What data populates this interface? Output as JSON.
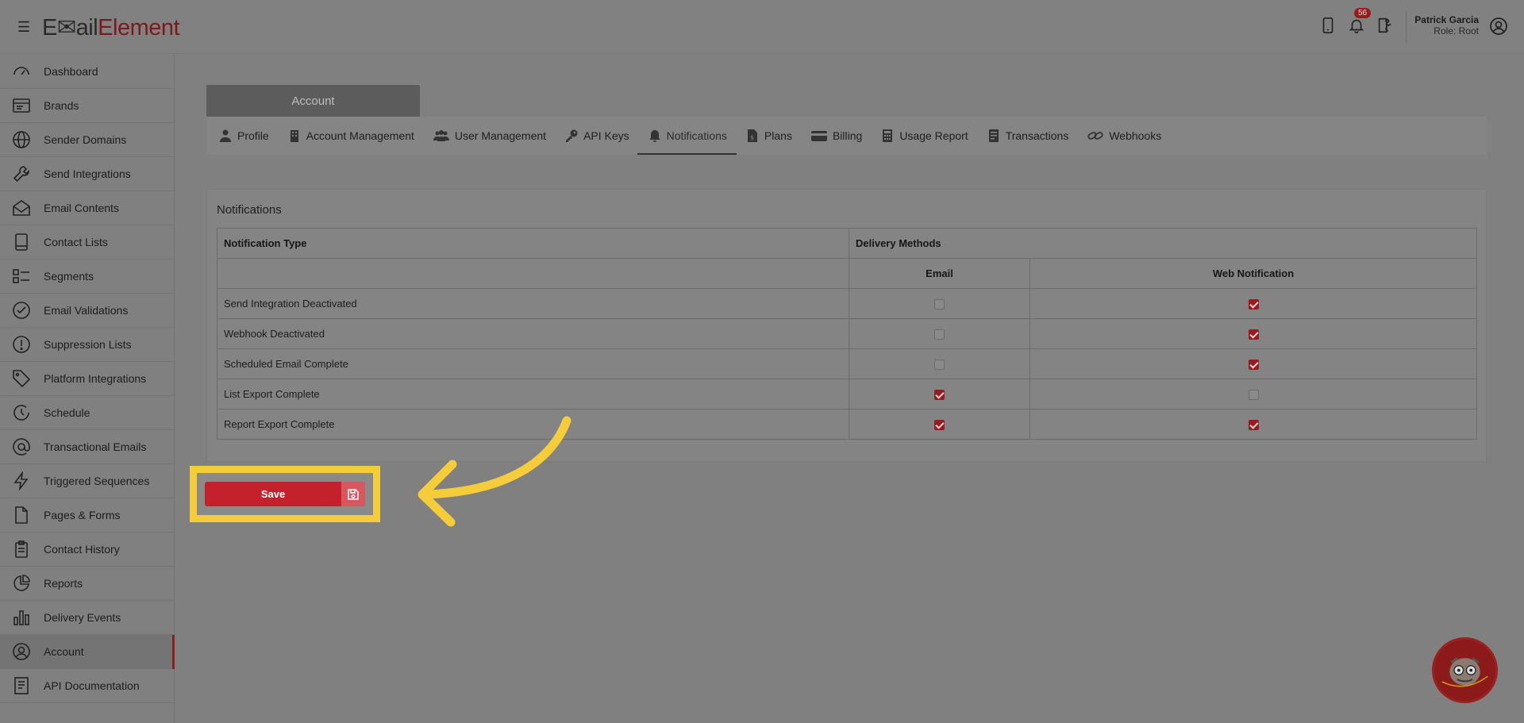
{
  "header": {
    "logo_part1": "E",
    "logo_part2": "ail",
    "logo_part3": "Element",
    "notification_count": "56",
    "user_name": "Patrick Garcia",
    "user_role": "Role: Root"
  },
  "sidebar": {
    "items": [
      {
        "label": "Dashboard",
        "icon": "gauge-icon"
      },
      {
        "label": "Brands",
        "icon": "brands-icon"
      },
      {
        "label": "Sender Domains",
        "icon": "globe-icon"
      },
      {
        "label": "Send Integrations",
        "icon": "wrench-icon"
      },
      {
        "label": "Email Contents",
        "icon": "envelope-open-icon"
      },
      {
        "label": "Contact Lists",
        "icon": "book-icon"
      },
      {
        "label": "Segments",
        "icon": "segments-icon"
      },
      {
        "label": "Email Validations",
        "icon": "check-circle-icon"
      },
      {
        "label": "Suppression Lists",
        "icon": "exclamation-circle-icon"
      },
      {
        "label": "Platform Integrations",
        "icon": "tag-icon"
      },
      {
        "label": "Schedule",
        "icon": "clock-icon"
      },
      {
        "label": "Transactional Emails",
        "icon": "at-icon"
      },
      {
        "label": "Triggered Sequences",
        "icon": "lightning-icon"
      },
      {
        "label": "Pages & Forms",
        "icon": "file-icon"
      },
      {
        "label": "Contact History",
        "icon": "clipboard-icon"
      },
      {
        "label": "Reports",
        "icon": "pie-chart-icon"
      },
      {
        "label": "Delivery Events",
        "icon": "bar-chart-icon"
      },
      {
        "label": "Account",
        "icon": "user-circle-icon",
        "active": true
      },
      {
        "label": "API Documentation",
        "icon": "doc-icon"
      }
    ]
  },
  "account_tab": "Account",
  "tabs": [
    {
      "label": "Profile",
      "icon": "person-icon"
    },
    {
      "label": "Account Management",
      "icon": "building-icon"
    },
    {
      "label": "User Management",
      "icon": "users-icon"
    },
    {
      "label": "API Keys",
      "icon": "key-icon"
    },
    {
      "label": "Notifications",
      "icon": "bell-icon",
      "active": true
    },
    {
      "label": "Plans",
      "icon": "file-dollar-icon"
    },
    {
      "label": "Billing",
      "icon": "credit-card-icon"
    },
    {
      "label": "Usage Report",
      "icon": "calculator-icon"
    },
    {
      "label": "Transactions",
      "icon": "receipt-icon"
    },
    {
      "label": "Webhooks",
      "icon": "link-icon"
    }
  ],
  "notifications": {
    "title": "Notifications",
    "col_type": "Notification Type",
    "col_methods": "Delivery Methods",
    "col_email": "Email",
    "col_web": "Web Notification",
    "rows": [
      {
        "type": "Send Integration Deactivated",
        "email": false,
        "web": true
      },
      {
        "type": "Webhook Deactivated",
        "email": false,
        "web": true
      },
      {
        "type": "Scheduled Email Complete",
        "email": false,
        "web": true
      },
      {
        "type": "List Export Complete",
        "email": true,
        "web": false
      },
      {
        "type": "Report Export Complete",
        "email": true,
        "web": true
      }
    ]
  },
  "save_label": "Save",
  "colors": {
    "accent": "#c3212b",
    "highlight": "#f5cd3a"
  }
}
